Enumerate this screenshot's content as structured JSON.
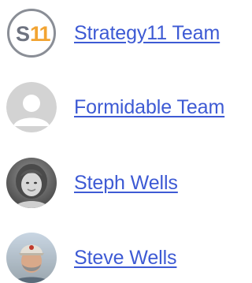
{
  "authors": [
    {
      "name": "Strategy11 Team",
      "avatar_icon": "s11-logo-avatar"
    },
    {
      "name": "Formidable Team",
      "avatar_icon": "default-user-avatar"
    },
    {
      "name": "Steph Wells",
      "avatar_icon": "woman-photo-avatar"
    },
    {
      "name": "Steve Wells",
      "avatar_icon": "man-with-cap-photo-avatar"
    }
  ],
  "logo": {
    "text": "S11"
  },
  "colors": {
    "link": "#3d5ad4",
    "logo_s": "#6e7380",
    "logo_11": "#f2a432",
    "default_avatar_bg": "#d3d3d3",
    "default_avatar_fg": "#ffffff"
  }
}
